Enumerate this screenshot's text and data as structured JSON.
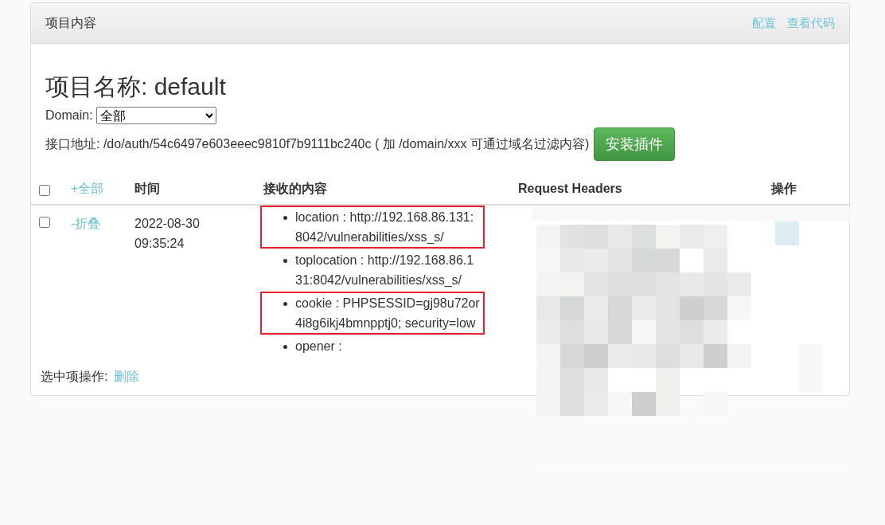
{
  "panel": {
    "title": "项目内容",
    "links": [
      "配置",
      "查看代码"
    ]
  },
  "project": {
    "heading": "项目名称: default",
    "domain_label": "Domain:",
    "domain_value": "全部",
    "endpoint_text": "接口地址: /do/auth/54c6497e603eeec9810f7b9111bc240c ( 加 /domain/xxx 可通过域名过滤内容)",
    "install_button": "安装插件"
  },
  "table": {
    "select_all": {
      "checked": false
    },
    "expand_all": "+全部",
    "columns": [
      "时间",
      "接收的内容",
      "Request Headers",
      "操作"
    ],
    "rows": [
      {
        "checked": false,
        "toggle": "-折叠",
        "time": "2022-08-30 09:35:24",
        "content": [
          {
            "text": "location : http://192.168.86.131:8042/vulnerabilities/xss_s/",
            "highlighted": true
          },
          {
            "text": "toplocation : http://192.168.86.131:8042/vulnerabilities/xss_s/",
            "highlighted": false
          },
          {
            "text": "cookie : PHPSESSID=gj98u72or4i8g6ikj4bmnpptj0; security=low",
            "highlighted": true
          },
          {
            "text": "opener :",
            "highlighted": false
          }
        ]
      }
    ]
  },
  "footer": {
    "label": "选中项操作:",
    "action": "删除"
  }
}
